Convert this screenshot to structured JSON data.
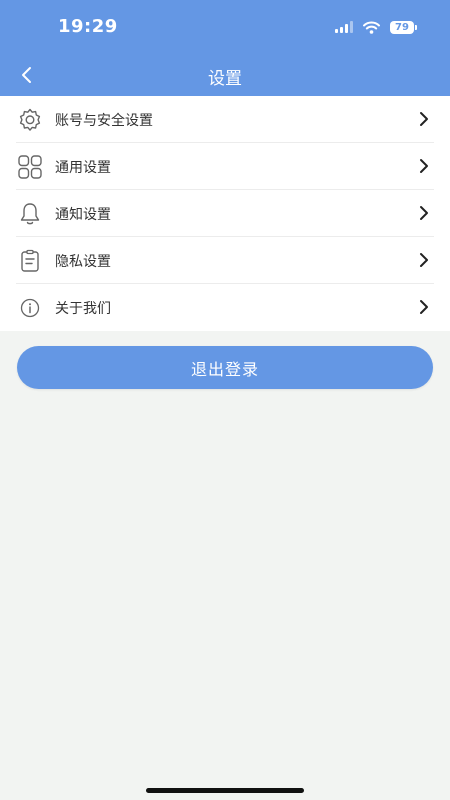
{
  "status_bar": {
    "time": "19:29",
    "battery": "79"
  },
  "header": {
    "title": "设置"
  },
  "menu": {
    "items": [
      {
        "label": "账号与安全设置",
        "icon": "gear-icon"
      },
      {
        "label": "通用设置",
        "icon": "grid-icon"
      },
      {
        "label": "通知设置",
        "icon": "bell-icon"
      },
      {
        "label": "隐私设置",
        "icon": "clipboard-icon"
      },
      {
        "label": "关于我们",
        "icon": "info-icon"
      }
    ]
  },
  "logout_label": "退出登录",
  "colors": {
    "accent": "#6497e4",
    "background": "#f2f4f2"
  }
}
